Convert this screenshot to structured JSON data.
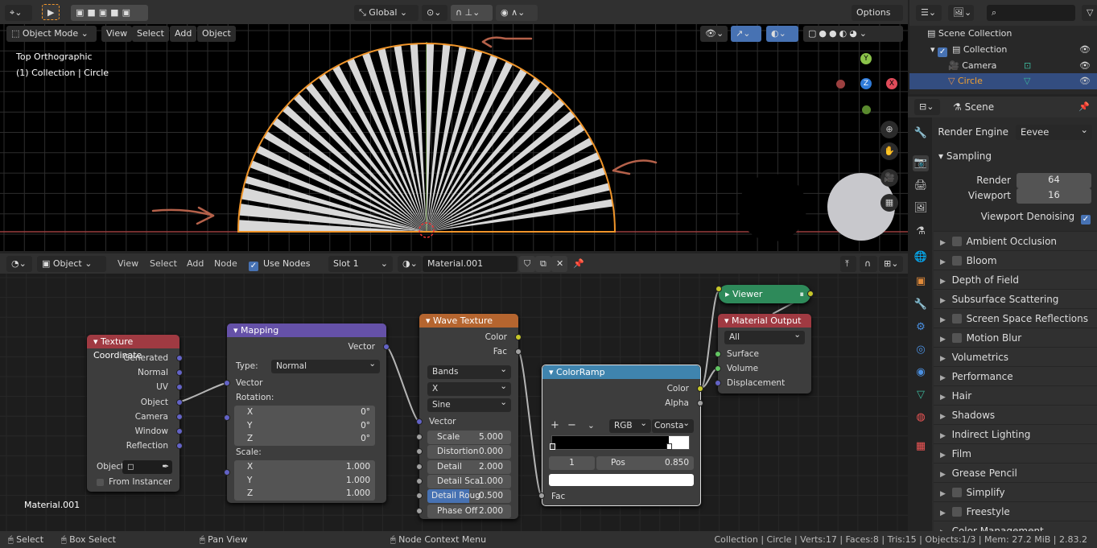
{
  "top_header": {
    "transform_orientation": "Global",
    "options": "Options"
  },
  "viewport": {
    "mode": "Object Mode",
    "menus": [
      "View",
      "Select",
      "Add",
      "Object"
    ],
    "view_name": "Top Orthographic",
    "collection_info": "(1) Collection | Circle",
    "gizmo_axes": {
      "x": "X",
      "y": "Y",
      "z": "Z"
    },
    "colors": {
      "selection": "#f0952a",
      "x_axis": "#9b3f3f",
      "y_axis": "#5a8a2e",
      "annotation": "#b5614a"
    }
  },
  "node_editor": {
    "header": {
      "editor_type": "Object",
      "menus": [
        "View",
        "Select",
        "Add",
        "Node"
      ],
      "use_nodes": "Use Nodes",
      "slot": "Slot 1",
      "material": "Material.001"
    },
    "material_label": "Material.001",
    "texture_coordinate": {
      "title": "Texture Coordinate",
      "outputs": [
        "Generated",
        "Normal",
        "UV",
        "Object",
        "Camera",
        "Window",
        "Reflection"
      ],
      "object_label": "Object",
      "from_instancer": "From Instancer",
      "color": "#a03a42"
    },
    "mapping": {
      "title": "Mapping",
      "output": "Vector",
      "type_label": "Type:",
      "type_value": "Normal",
      "vector": "Vector",
      "rotation_label": "Rotation:",
      "rotation": [
        {
          "axis": "X",
          "value": "0°"
        },
        {
          "axis": "Y",
          "value": "0°"
        },
        {
          "axis": "Z",
          "value": "0°"
        }
      ],
      "scale_label": "Scale:",
      "scale": [
        {
          "axis": "X",
          "value": "1.000"
        },
        {
          "axis": "Y",
          "value": "1.000"
        },
        {
          "axis": "Z",
          "value": "1.000"
        }
      ],
      "color": "#6551a8"
    },
    "wave_texture": {
      "title": "Wave Texture",
      "outputs": [
        "Color",
        "Fac"
      ],
      "dropdowns": [
        "Bands",
        "X",
        "Sine"
      ],
      "vector": "Vector",
      "fields": [
        {
          "label": "Scale",
          "value": "5.000"
        },
        {
          "label": "Distortion",
          "value": "0.000"
        },
        {
          "label": "Detail",
          "value": "2.000"
        },
        {
          "label": "Detail Sca",
          "value": "1.000"
        },
        {
          "label": "Detail Roug",
          "value": "0.500"
        },
        {
          "label": "Phase Off",
          "value": "2.000"
        }
      ],
      "detail_roughness_fraction": 0.5,
      "color": "#b5652f"
    },
    "color_ramp": {
      "title": "ColorRamp",
      "outputs": [
        "Color",
        "Alpha"
      ],
      "plus": "+",
      "minus": "−",
      "color_mode": "RGB",
      "interpolation": "Consta",
      "index": "1",
      "pos_label": "Pos",
      "pos_value": "0.850",
      "input": "Fac",
      "stop_position": 0.85,
      "color": "#3f84ae"
    },
    "viewer": {
      "title": "Viewer",
      "color": "#2e8a5a"
    },
    "material_output": {
      "title": "Material Output",
      "target": "All",
      "inputs": [
        "Surface",
        "Volume",
        "Displacement"
      ],
      "color": "#a03a42"
    }
  },
  "outliner": {
    "items": [
      {
        "label": "Scene Collection"
      },
      {
        "label": "Collection"
      },
      {
        "label": "Camera"
      },
      {
        "label": "Circle",
        "selected": true
      }
    ]
  },
  "properties": {
    "context": "Scene",
    "render_engine_label": "Render Engine",
    "render_engine": "Eevee",
    "sampling": "Sampling",
    "render_label": "Render",
    "render_value": "64",
    "viewport_label": "Viewport",
    "viewport_value": "16",
    "viewport_denoising": "Viewport Denoising",
    "panels": [
      {
        "label": "Ambient Occlusion",
        "checkbox": true
      },
      {
        "label": "Bloom",
        "checkbox": true
      },
      {
        "label": "Depth of Field"
      },
      {
        "label": "Subsurface Scattering"
      },
      {
        "label": "Screen Space Reflections",
        "checkbox": true
      },
      {
        "label": "Motion Blur",
        "checkbox": true
      },
      {
        "label": "Volumetrics"
      },
      {
        "label": "Performance"
      },
      {
        "label": "Hair"
      },
      {
        "label": "Shadows"
      },
      {
        "label": "Indirect Lighting"
      },
      {
        "label": "Film"
      },
      {
        "label": "Grease Pencil"
      },
      {
        "label": "Simplify",
        "checkbox": true
      },
      {
        "label": "Freestyle",
        "checkbox": true
      },
      {
        "label": "Color Management"
      }
    ]
  },
  "status_bar": {
    "select": "Select",
    "box_select": "Box Select",
    "pan_view": "Pan View",
    "node_context_menu": "Node Context Menu",
    "stats": "Collection | Circle | Verts:17 | Faces:8 | Tris:15 | Objects:1/3 | Mem: 27.2 MiB | 2.83.2"
  }
}
